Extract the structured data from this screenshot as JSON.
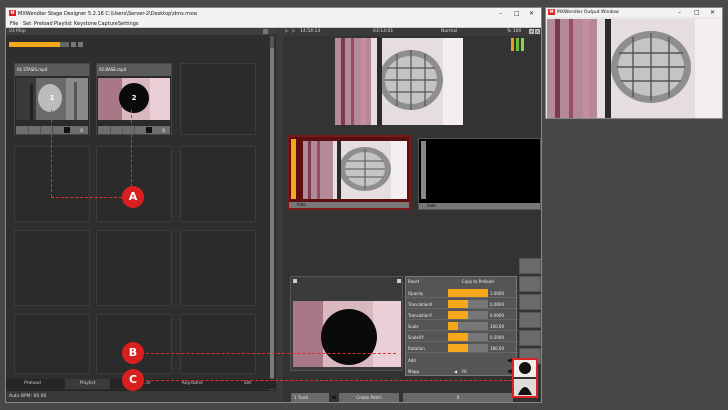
{
  "main_window": {
    "title": "MXWendler Stage Designer 5.2.16  C:\\Users\\Server-2\\Desktop\\dms.mxw",
    "menu": [
      "File",
      "Set",
      "Preload",
      "Playlist",
      "Keystone",
      "Capture",
      "Settings"
    ]
  },
  "left_panel": {
    "header": "03 Map",
    "map_progress": 0.85,
    "clips": [
      {
        "title": "01.STASIS.mp4",
        "number": "1",
        "ctrl_label": "X"
      },
      {
        "title": "02.BASE.mp4",
        "number": "2",
        "ctrl_label": "X"
      }
    ],
    "bottom_tabs": [
      "Preload",
      "Playlist",
      "Ti...er",
      "Keystone",
      "Set"
    ],
    "bpm_text": "Auto BPM: 60.00"
  },
  "right_panel": {
    "transport": {
      "time_left": "14:54:14",
      "time_center": "03:14:01",
      "mode": "Normal",
      "percent": "% 100"
    },
    "deck_a_label": "fade",
    "deck_b_label": "fade",
    "props_header_left": "Reset",
    "props_header_right": "Copy to Preload",
    "properties": [
      {
        "label": "Opacity",
        "value": "1.0000",
        "fill": 1.0
      },
      {
        "label": "TranslationX",
        "value": "0.0000",
        "fill": 0.5
      },
      {
        "label": "TranslationY",
        "value": "0.0000",
        "fill": 0.5
      },
      {
        "label": "Scale",
        "value": "100.00",
        "fill": 0.25
      },
      {
        "label": "ScaleXY",
        "value": "0.5000",
        "fill": 0.5
      },
      {
        "label": "Rotation",
        "value": "180.00",
        "fill": 0.5
      }
    ],
    "add_label": "Add",
    "mapping_label": "Mapp.",
    "mapping_value": "Fit",
    "bottom_buttons": {
      "track": "1 Track",
      "create_patch": "Create Patch",
      "close": "X"
    }
  },
  "output_window": {
    "title": "MXWendler Output Window"
  },
  "annotations": [
    "A",
    "B",
    "C"
  ],
  "colors": {
    "accent_orange": "#f5a81c",
    "annotation_red": "#d9201f",
    "deck_red": "#7a1a1a"
  }
}
